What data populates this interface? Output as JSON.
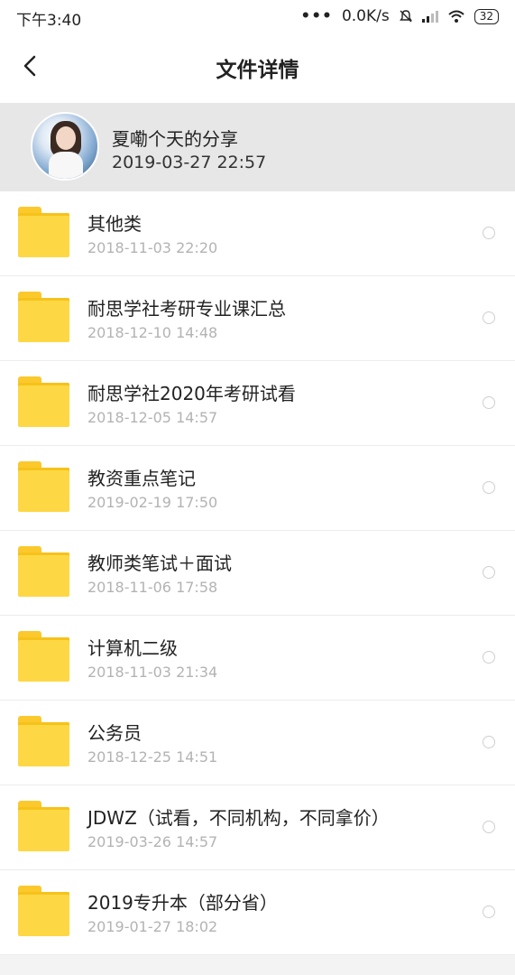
{
  "status_bar": {
    "time": "下午3:40",
    "dots": "•••",
    "net_speed": "0.0K/s",
    "battery": "32"
  },
  "nav": {
    "title": "文件详情"
  },
  "share": {
    "name": "夏嘞个天的分享",
    "date": "2019-03-27  22:57"
  },
  "files": [
    {
      "name": "其他类",
      "date": "2018-11-03  22:20"
    },
    {
      "name": "耐思学社考研专业课汇总",
      "date": "2018-12-10  14:48"
    },
    {
      "name": "耐思学社2020年考研试看",
      "date": "2018-12-05  14:57"
    },
    {
      "name": "教资重点笔记",
      "date": "2019-02-19  17:50"
    },
    {
      "name": "教师类笔试＋面试",
      "date": "2018-11-06  17:58"
    },
    {
      "name": "计算机二级",
      "date": "2018-11-03  21:34"
    },
    {
      "name": "公务员",
      "date": "2018-12-25  14:51"
    },
    {
      "name": "JDWZ（试看，不同机构，不同拿价）",
      "date": "2019-03-26  14:57"
    },
    {
      "name": "2019专升本（部分省）",
      "date": "2019-01-27  18:02"
    }
  ],
  "colors": {
    "folder": "#fed844",
    "folder_tab": "#fbc92c",
    "header_bg": "#e7e7e7"
  },
  "icons": [
    "back-arrow-icon",
    "folder-icon",
    "radio-icon",
    "mute-icon",
    "signal-icon",
    "wifi-icon",
    "battery-icon"
  ]
}
